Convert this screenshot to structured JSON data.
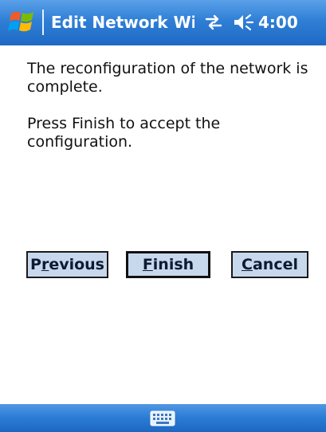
{
  "titlebar": {
    "title": "Edit Network Wizar",
    "time": "4:00",
    "start_icon": "windows-flag-icon",
    "connectivity_icon": "connectivity-icon",
    "volume_icon": "volume-icon",
    "bg_color": "#2f7fd6"
  },
  "content": {
    "message_complete": "The reconfiguration of the network is complete.",
    "message_instruction": "Press Finish to accept the configuration."
  },
  "buttons": {
    "previous": {
      "first": "P",
      "accel": "r",
      "rest": "evious"
    },
    "finish": {
      "first": "",
      "accel": "F",
      "rest": "inish"
    },
    "cancel": {
      "first": "",
      "accel": "C",
      "rest": "ancel"
    }
  },
  "menubar": {
    "input_icon": "keyboard-icon",
    "bg_color": "#2a7bd3"
  }
}
